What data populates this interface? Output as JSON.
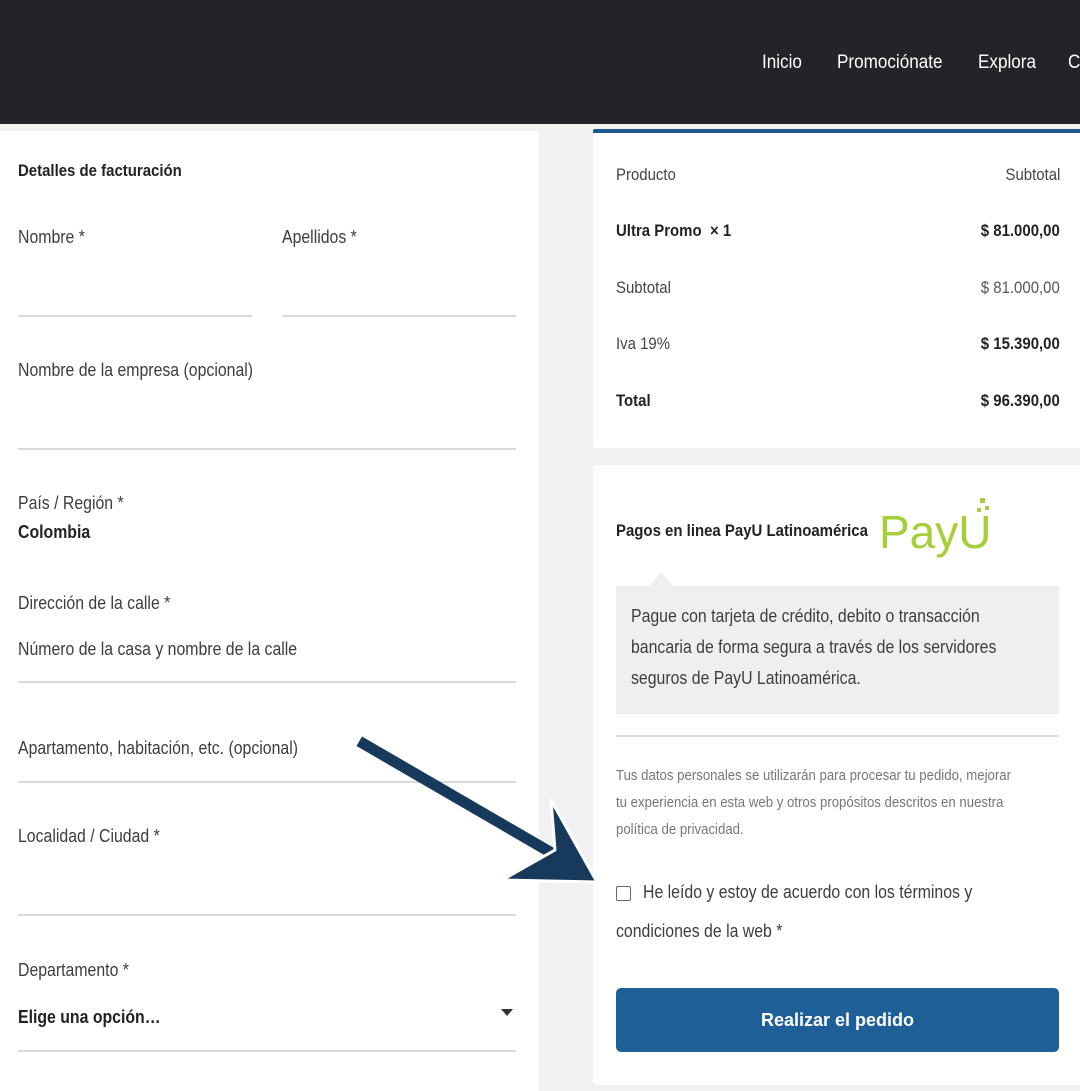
{
  "nav": {
    "items": [
      "Inicio",
      "Promociónate",
      "Explora",
      "C"
    ]
  },
  "billing": {
    "title": "Detalles de facturación",
    "first_name_label": "Nombre *",
    "last_name_label": "Apellidos *",
    "company_label": "Nombre de la empresa (opcional)",
    "country_label": "País / Región *",
    "country_value": "Colombia",
    "street_label": "Dirección de la calle *",
    "street_placeholder": "Número de la casa y nombre de la calle",
    "apartment_placeholder": "Apartamento, habitación, etc. (opcional)",
    "city_label": "Localidad / Ciudad *",
    "state_label": "Departamento *",
    "state_value": "Elige una opción…"
  },
  "order": {
    "col_product": "Producto",
    "col_subtotal": "Subtotal",
    "item_name": "Ultra Promo",
    "item_qty": "× 1",
    "item_total": "$ 81.000,00",
    "subtotal_label": "Subtotal",
    "subtotal_value": "$ 81.000,00",
    "tax_label": "Iva 19%",
    "tax_value": "$ 15.390,00",
    "total_label": "Total",
    "total_value": "$ 96.390,00"
  },
  "payment": {
    "method_label": "Pagos en linea PayU Latinoamérica",
    "logo_text": "PayU",
    "description_lines": [
      "Pague con tarjeta de crédito, debito o transacción",
      "bancaria de forma segura a través de los servidores",
      "seguros de PayU Latinoamérica."
    ],
    "privacy_lines": [
      "Tus datos personales se utilizarán para procesar tu pedido, mejorar",
      "tu experiencia en esta web y otros propósitos descritos en nuestra",
      "política de privacidad."
    ],
    "terms_lines": [
      "He leído y estoy de acuerdo con los términos y",
      "condiciones de la web *"
    ],
    "terms_checked": false,
    "submit_label": "Realizar el pedido"
  },
  "colors": {
    "topbar": "#232428",
    "button": "#1e5f97",
    "payu_green": "#a6ce39",
    "arrow": "#173a5c"
  }
}
